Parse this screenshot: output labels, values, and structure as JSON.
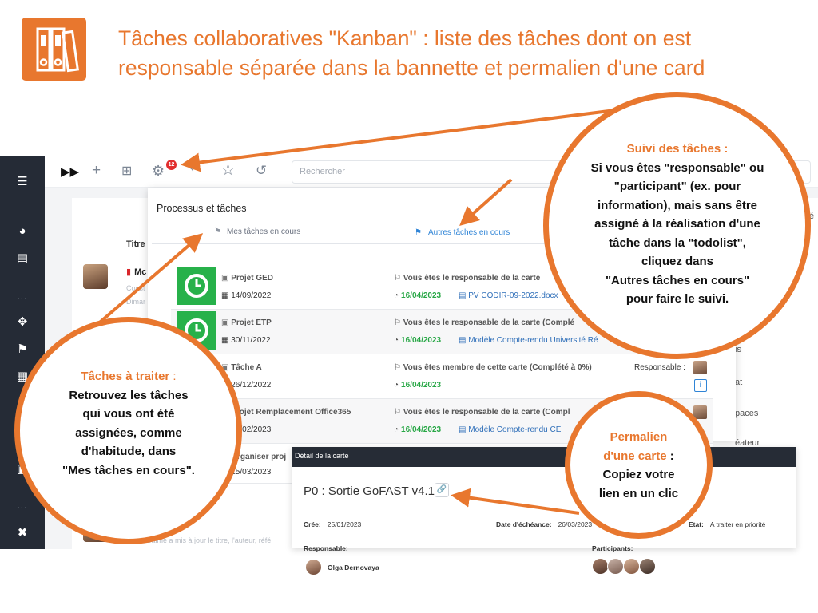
{
  "slide": {
    "title_line1": "Tâches collaboratives \"Kanban\" : liste des tâches dont on est",
    "title_line2": "responsable séparée dans la bannette et permalien d'une card",
    "accent": "#e8772e"
  },
  "toolbar": {
    "notification_count": "12",
    "search_placeholder": "Rechercher"
  },
  "background_page": {
    "column_title": "Titre",
    "item_label": "Mc",
    "grey_line1": "Const",
    "grey_line2": "Dimar",
    "activity_text": "Steve Balme a mis à jour le titre, l'auteur, réfé",
    "right_items": [
      "é",
      "is",
      "at",
      "paces",
      "éateur"
    ]
  },
  "panel": {
    "title": "Processus et tâches",
    "tab_mine": "Mes tâches en cours",
    "tab_others": "Autres tâches en cours",
    "rows": [
      {
        "project": "Projet GED",
        "date": "14/09/2022",
        "role": "Vous êtes le responsable de la carte",
        "due": "16/04/2023",
        "doc": "PV CODIR-09-2022.docx"
      },
      {
        "project": "Projet ETP",
        "date": "30/11/2022",
        "role": "Vous êtes le responsable de la carte (Complé",
        "due": "16/04/2023",
        "doc": "Modèle Compte-rendu Université Ré"
      },
      {
        "project": "Tâche A",
        "date": "26/12/2022",
        "role": "Vous êtes membre de cette carte (Complété à 0%)",
        "due": "16/04/2023",
        "doc": "",
        "responsable": "Responsable :"
      },
      {
        "project": "Projet Remplacement Office365",
        "date": "22/02/2023",
        "role": "Vous êtes le responsable de la carte (Compl",
        "due": "16/04/2023",
        "doc": "Modèle Compte-rendu CE"
      },
      {
        "project": "Organiser proj",
        "date": "15/03/2023",
        "role": "",
        "due": "",
        "doc": ""
      }
    ]
  },
  "detail": {
    "header": "Détail de la carte",
    "card_title": "P0 : Sortie GoFAST v4.1",
    "created_label": "Crée:",
    "created_value": "25/01/2023",
    "due_label": "Date d'échéance:",
    "due_value": "26/03/2023",
    "state_label": "Etat:",
    "state_value": "A traiter en priorité",
    "responsable_label": "Responsable:",
    "responsable_name": "Olga Dernovaya",
    "participants_label": "Participants:"
  },
  "annotations": {
    "suivi": {
      "title": "Suivi des tâches :",
      "body": [
        "Si vous êtes \"responsable\" ou",
        "\"participant\" (ex. pour",
        "information), mais sans être",
        "assigné à la réalisation d'une",
        "tâche dans la \"todolist\",",
        "cliquez dans",
        "\"Autres tâches en cours\"",
        "pour faire le suivi."
      ]
    },
    "traiter": {
      "title": "Tâches à traiter",
      "title_suffix": " :",
      "body": [
        "Retrouvez les tâches",
        "qui vous ont été",
        "assignées, comme",
        "d'habitude, dans",
        "\"Mes tâches en cours\"."
      ]
    },
    "permalien": {
      "title1": "Permalien",
      "title2": "d'une carte",
      "title_suffix": " :",
      "body": [
        "Copiez votre",
        "lien en un clic"
      ]
    }
  }
}
